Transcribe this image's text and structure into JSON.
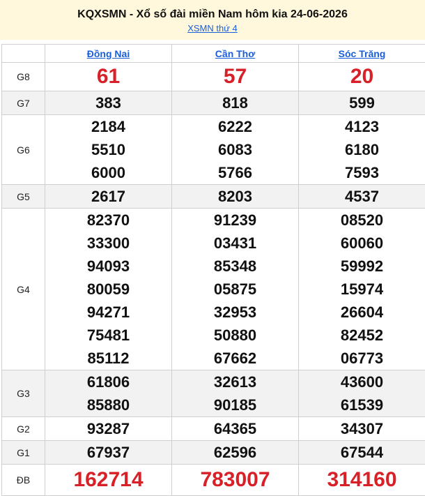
{
  "header": {
    "title": "KQXSMN - Xổ số đài miền Nam hôm kia 24-06-2026",
    "subtitle_link": "XSMN thứ 4"
  },
  "provinces": [
    "Đồng Nai",
    "Cần Thơ",
    "Sóc Trăng"
  ],
  "prizes": [
    {
      "label": "G8",
      "shade": false,
      "style": "big",
      "values": [
        [
          "61"
        ],
        [
          "57"
        ],
        [
          "20"
        ]
      ]
    },
    {
      "label": "G7",
      "shade": true,
      "style": "num",
      "values": [
        [
          "383"
        ],
        [
          "818"
        ],
        [
          "599"
        ]
      ]
    },
    {
      "label": "G6",
      "shade": false,
      "style": "num",
      "values": [
        [
          "2184",
          "5510",
          "6000"
        ],
        [
          "6222",
          "6083",
          "5766"
        ],
        [
          "4123",
          "6180",
          "7593"
        ]
      ]
    },
    {
      "label": "G5",
      "shade": true,
      "style": "num",
      "values": [
        [
          "2617"
        ],
        [
          "8203"
        ],
        [
          "4537"
        ]
      ]
    },
    {
      "label": "G4",
      "shade": false,
      "style": "num",
      "values": [
        [
          "82370",
          "33300",
          "94093",
          "80059",
          "94271",
          "75481",
          "85112"
        ],
        [
          "91239",
          "03431",
          "85348",
          "05875",
          "32953",
          "50880",
          "67662"
        ],
        [
          "08520",
          "60060",
          "59992",
          "15974",
          "26604",
          "82452",
          "06773"
        ]
      ]
    },
    {
      "label": "G3",
      "shade": true,
      "style": "num",
      "values": [
        [
          "61806",
          "85880"
        ],
        [
          "32613",
          "90185"
        ],
        [
          "43600",
          "61539"
        ]
      ]
    },
    {
      "label": "G2",
      "shade": false,
      "style": "num",
      "values": [
        [
          "93287"
        ],
        [
          "64365"
        ],
        [
          "34307"
        ]
      ]
    },
    {
      "label": "G1",
      "shade": true,
      "style": "num",
      "values": [
        [
          "67937"
        ],
        [
          "62596"
        ],
        [
          "67544"
        ]
      ]
    },
    {
      "label": "ĐB",
      "shade": false,
      "style": "jack",
      "values": [
        [
          "162714"
        ],
        [
          "783007"
        ],
        [
          "314160"
        ]
      ]
    }
  ],
  "colors": {
    "header_bg": "#fff8dc",
    "link": "#1a5fd8",
    "highlight_red": "#d72027",
    "row_shade": "#f2f2f2"
  }
}
